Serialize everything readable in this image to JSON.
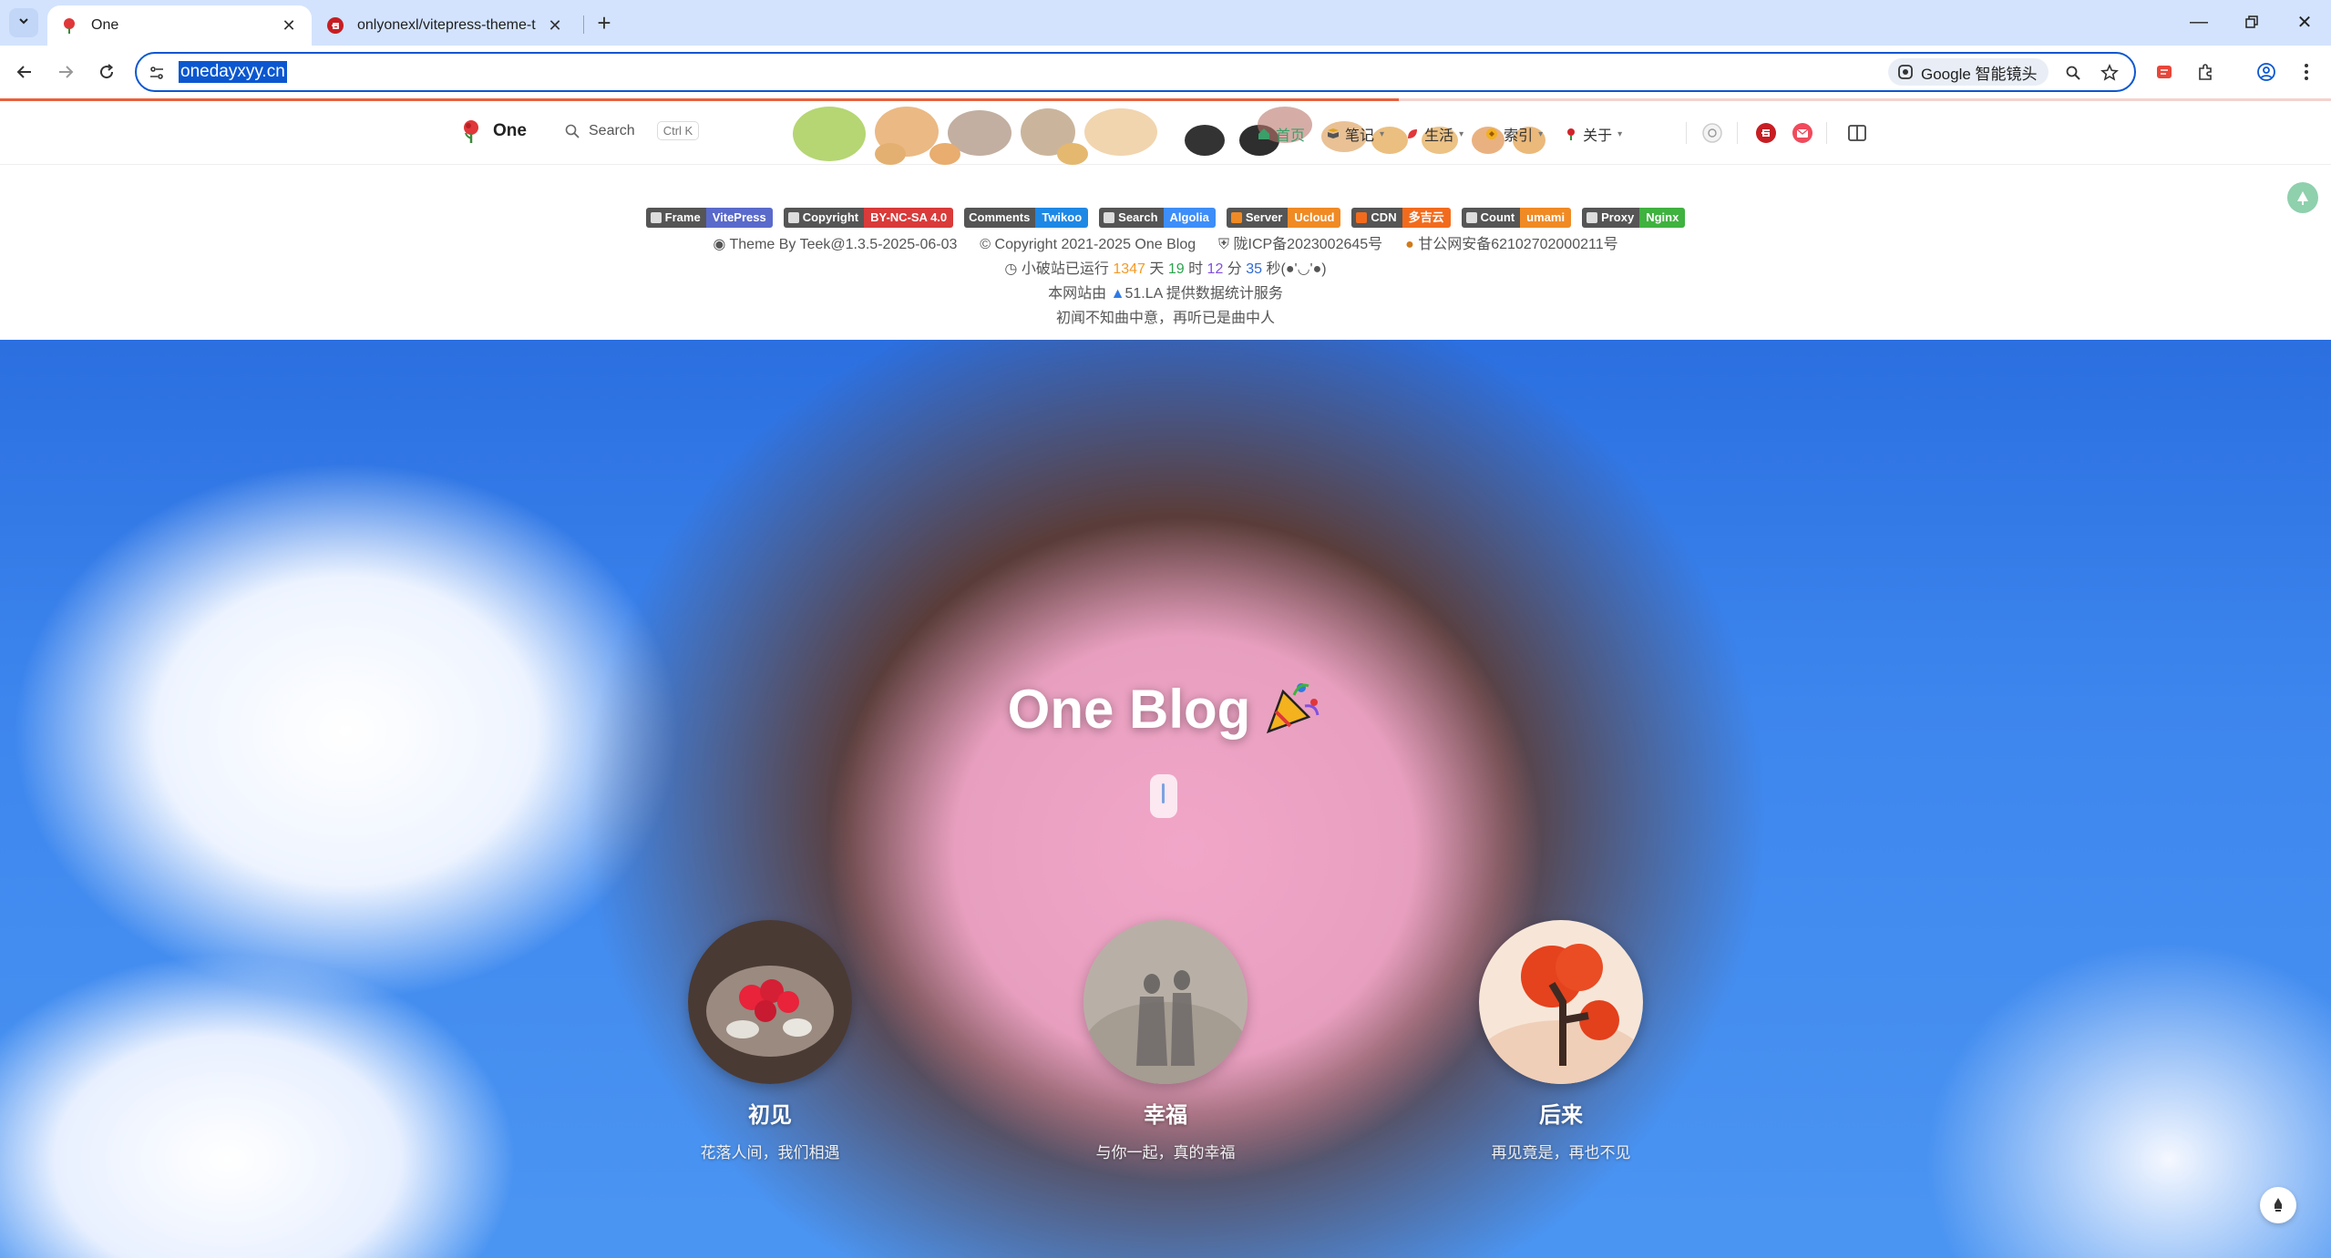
{
  "browser": {
    "tabs": [
      {
        "title": "One",
        "active": true
      },
      {
        "title": "onlyonexl/vitepress-theme-t",
        "active": false
      }
    ],
    "url": "onedayxyy.cn",
    "lens_label": "Google 智能镜头"
  },
  "site": {
    "brand": "One",
    "search_label": "Search",
    "search_shortcut": "Ctrl K",
    "menu": [
      {
        "label": "首页",
        "icon": "home-icon",
        "has_dropdown": false,
        "active": true
      },
      {
        "label": "笔记",
        "icon": "book-icon",
        "has_dropdown": true
      },
      {
        "label": "生活",
        "icon": "leaf-icon",
        "has_dropdown": true
      },
      {
        "label": "索引",
        "icon": "index-icon",
        "has_dropdown": true
      },
      {
        "label": "关于",
        "icon": "heart-icon",
        "has_dropdown": true
      }
    ]
  },
  "footer": {
    "badges": [
      {
        "key": "Frame",
        "value": "VitePress",
        "color": "#5a6acb"
      },
      {
        "key": "Copyright",
        "value": "BY-NC-SA 4.0",
        "color": "#d93a3a"
      },
      {
        "key": "Comments",
        "value": "Twikoo",
        "color": "#1e88e5"
      },
      {
        "key": "Search",
        "value": "Algolia",
        "color": "#3d8ef8"
      },
      {
        "key": "Server",
        "value": "Ucloud",
        "color": "#f08a24"
      },
      {
        "key": "CDN",
        "value": "多吉云",
        "color": "#f26b1d"
      },
      {
        "key": "Count",
        "value": "umami",
        "color": "#f08a24"
      },
      {
        "key": "Proxy",
        "value": "Nginx",
        "color": "#3fb23f"
      }
    ],
    "theme": "Theme By Teek@1.3.5-2025-06-03",
    "copyright": "Copyright 2021-2025 One Blog",
    "icp": "陇ICP备2023002645号",
    "police": "甘公网安备62102702000211号",
    "runtime": {
      "prefix": "小破站已运行",
      "days": "1347",
      "days_unit": "天",
      "hours": "19",
      "hours_unit": "时",
      "minutes": "12",
      "minutes_unit": "分",
      "seconds": "35",
      "seconds_unit": "秒(●'◡'●)"
    },
    "stats_prefix": "本网站由",
    "stats_provider": "51.LA",
    "stats_suffix": "提供数据统计服务",
    "motto": "初闻不知曲中意，再听已是曲中人"
  },
  "hero": {
    "title": "One Blog",
    "features": [
      {
        "title": "初见",
        "desc": "花落人间，我们相遇"
      },
      {
        "title": "幸福",
        "desc": "与你一起，真的幸福"
      },
      {
        "title": "后来",
        "desc": "再见竟是，再也不见"
      }
    ]
  }
}
